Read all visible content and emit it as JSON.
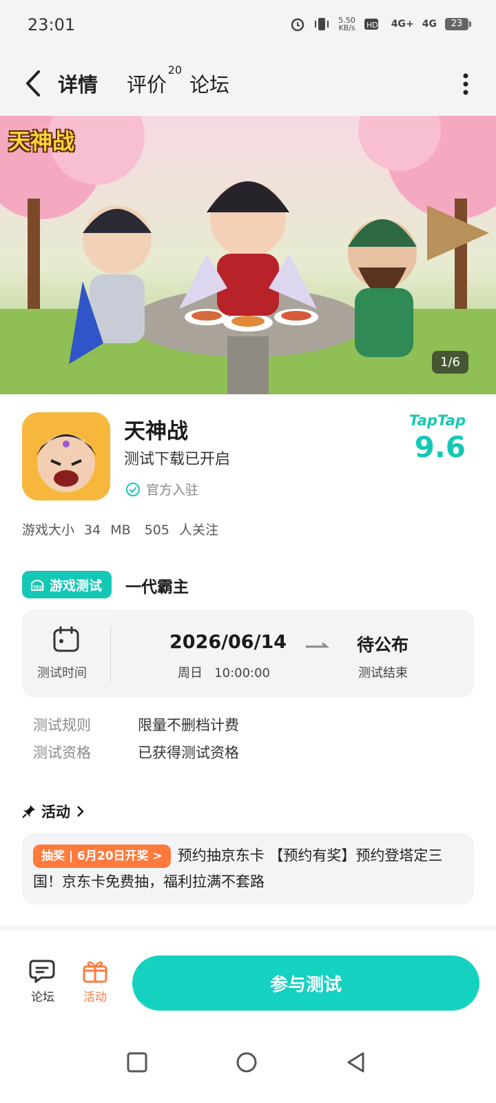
{
  "status_bar": {
    "time": "23:01",
    "net_speed_top": "5.50",
    "net_speed_unit": "KB/s",
    "signal_1": "4G+",
    "signal_2": "4G",
    "battery": "23",
    "icons": [
      "alarm-icon",
      "vibrate-icon",
      "hd-icon",
      "signal-icon",
      "battery-icon"
    ]
  },
  "nav": {
    "tabs": [
      {
        "label": "详情",
        "active": true
      },
      {
        "label": "评价",
        "count": "20"
      },
      {
        "label": "论坛"
      }
    ]
  },
  "banner": {
    "logo_text": "天神战",
    "counter": "1/6"
  },
  "app": {
    "name": "天神战",
    "subtitle": "测试下载已开启",
    "official": "官方入驻",
    "rating_brand": "TapTap",
    "rating": "9.6"
  },
  "meta": {
    "size_label": "游戏大小",
    "size_value": "34",
    "size_unit": "MB",
    "followers_value": "505",
    "followers_label": "人关注"
  },
  "test": {
    "badge": "游戏测试",
    "name": "一代霸主",
    "time_label": "测试时间",
    "start_date": "2026/06/14",
    "start_week": "周日",
    "start_time": "10:00:00",
    "end_status": "待公布",
    "end_label": "测试结束",
    "rules": [
      {
        "key": "测试规则",
        "value": "限量不删档计费"
      },
      {
        "key": "测试资格",
        "value": "已获得测试资格"
      }
    ]
  },
  "activity": {
    "title": "活动",
    "tag": "抽奖 | 6月20日开奖 >",
    "text": "预约抽京东卡 【预约有奖】预约登塔定三国！京东卡免费抽，福利拉满不套路"
  },
  "bottom": {
    "forum_label": "论坛",
    "activity_label": "活动",
    "join_button": "参与测试"
  },
  "colors": {
    "accent": "#15d2c0",
    "orange": "#ff7a3d"
  }
}
